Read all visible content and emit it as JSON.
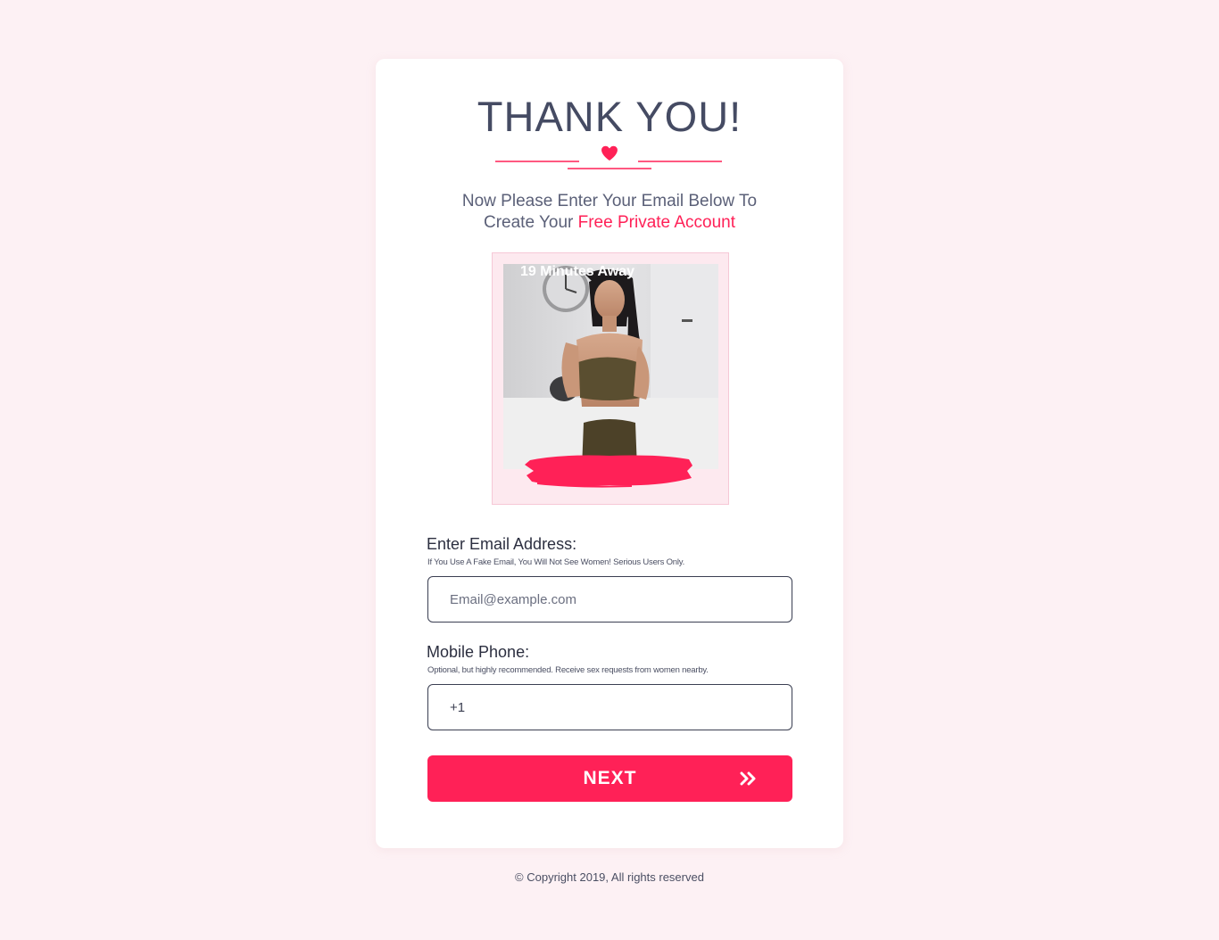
{
  "page": {
    "title": "THANK YOU!",
    "subtitle_line1": "Now Please Enter Your Email Below To",
    "subtitle_line2_prefix": "Create Your ",
    "subtitle_accent": "Free Private Account"
  },
  "profile": {
    "badge": "19 Minutes Away"
  },
  "email": {
    "label": "Enter Email Address:",
    "hint": "If You Use A Fake Email, You Will Not See Women! Serious Users Only.",
    "placeholder": "Email@example.com"
  },
  "phone": {
    "label": "Mobile Phone:",
    "hint": "Optional, but highly recommended. Receive sex requests from women nearby.",
    "value": "+1"
  },
  "actions": {
    "next_label": "NEXT"
  },
  "footer": {
    "copyright": "© Copyright 2019, All rights reserved"
  },
  "icons": {
    "divider": "heart-icon",
    "next": "double-chevron-right-icon"
  },
  "colors": {
    "accent": "#ff2157",
    "background": "#fdf1f4",
    "text": "#454b63"
  }
}
